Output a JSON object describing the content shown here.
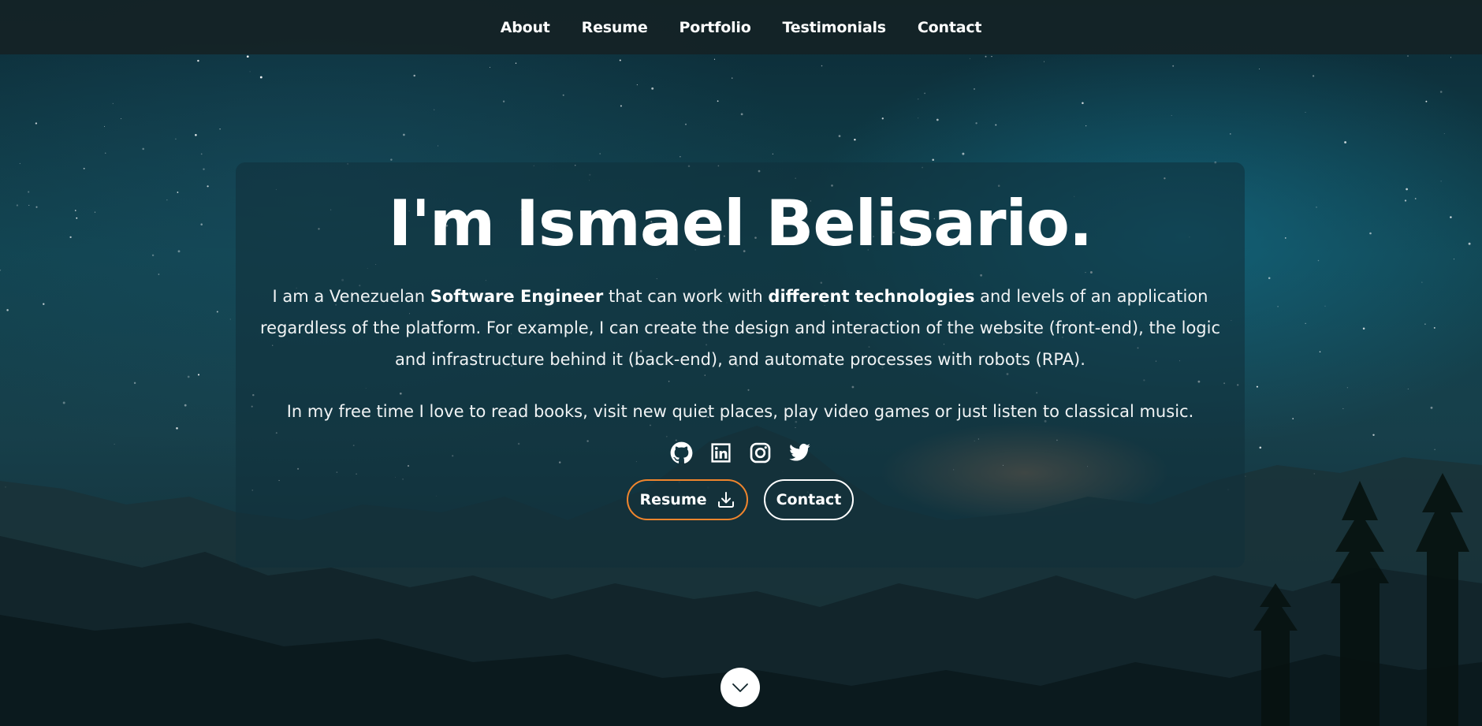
{
  "nav": {
    "items": [
      {
        "label": "About"
      },
      {
        "label": "Resume"
      },
      {
        "label": "Portfolio"
      },
      {
        "label": "Testimonials"
      },
      {
        "label": "Contact"
      }
    ]
  },
  "hero": {
    "title": "I'm Ismael Belisario.",
    "bio": {
      "part1": "I am a Venezuelan ",
      "bold1": "Software Engineer",
      "part2": " that can work with ",
      "bold2": "different technologies",
      "part3": " and levels of an application regardless of the platform. For example, I can create the design and interaction of the website (front-end), the logic and infrastructure behind it (back-end), and automate processes with robots (RPA)."
    },
    "hobbies": "In my free time I love to read books, visit new quiet places, play video games or just listen to classical music.",
    "socials": [
      {
        "icon": "github-icon"
      },
      {
        "icon": "linkedin-icon"
      },
      {
        "icon": "instagram-icon"
      },
      {
        "icon": "twitter-icon"
      }
    ],
    "buttons": {
      "resume_label": "Resume",
      "resume_icon": "download-icon",
      "contact_label": "Contact"
    }
  },
  "scroll_down": {
    "icon": "chevron-down-icon"
  },
  "colors": {
    "nav_background": "#142226",
    "accent_orange": "#f0852d",
    "text": "#ffffff"
  }
}
